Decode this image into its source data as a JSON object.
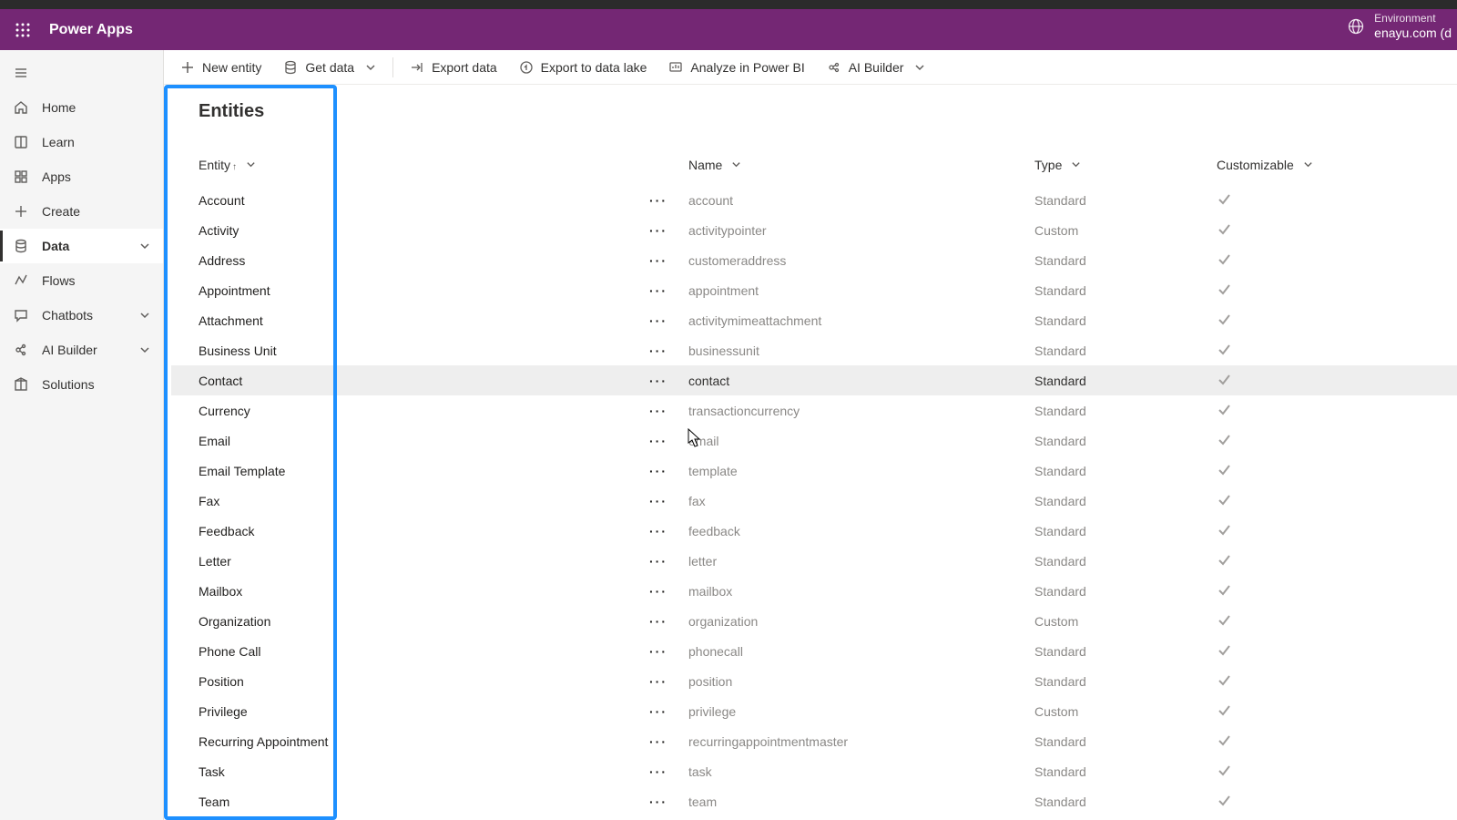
{
  "header": {
    "app_title": "Power Apps",
    "env_label": "Environment",
    "env_value": "enayu.com (d"
  },
  "nav": {
    "items": [
      {
        "key": "hamburger",
        "label": "",
        "icon": "menu",
        "chev": false
      },
      {
        "key": "home",
        "label": "Home",
        "icon": "home",
        "chev": false
      },
      {
        "key": "learn",
        "label": "Learn",
        "icon": "book",
        "chev": false
      },
      {
        "key": "apps",
        "label": "Apps",
        "icon": "apps",
        "chev": false
      },
      {
        "key": "create",
        "label": "Create",
        "icon": "plus",
        "chev": false
      },
      {
        "key": "data",
        "label": "Data",
        "icon": "data",
        "chev": true,
        "selected": true
      },
      {
        "key": "flows",
        "label": "Flows",
        "icon": "flows",
        "chev": false
      },
      {
        "key": "chatbots",
        "label": "Chatbots",
        "icon": "chat",
        "chev": true
      },
      {
        "key": "aibuilder",
        "label": "AI Builder",
        "icon": "ai",
        "chev": true
      },
      {
        "key": "solutions",
        "label": "Solutions",
        "icon": "package",
        "chev": false
      }
    ]
  },
  "toolbar": {
    "new_entity": "New entity",
    "get_data": "Get data",
    "export_data": "Export data",
    "export_lake": "Export to data lake",
    "analyze": "Analyze in Power BI",
    "ai_builder": "AI Builder"
  },
  "page": {
    "title": "Entities"
  },
  "columns": {
    "entity": "Entity",
    "name": "Name",
    "type": "Type",
    "customizable": "Customizable"
  },
  "rows": [
    {
      "entity": "Account",
      "name": "account",
      "type": "Standard",
      "cust": true
    },
    {
      "entity": "Activity",
      "name": "activitypointer",
      "type": "Custom",
      "cust": true
    },
    {
      "entity": "Address",
      "name": "customeraddress",
      "type": "Standard",
      "cust": true
    },
    {
      "entity": "Appointment",
      "name": "appointment",
      "type": "Standard",
      "cust": true
    },
    {
      "entity": "Attachment",
      "name": "activitymimeattachment",
      "type": "Standard",
      "cust": true
    },
    {
      "entity": "Business Unit",
      "name": "businessunit",
      "type": "Standard",
      "cust": true
    },
    {
      "entity": "Contact",
      "name": "contact",
      "type": "Standard",
      "cust": true,
      "selected": true
    },
    {
      "entity": "Currency",
      "name": "transactioncurrency",
      "type": "Standard",
      "cust": true
    },
    {
      "entity": "Email",
      "name": "email",
      "type": "Standard",
      "cust": true
    },
    {
      "entity": "Email Template",
      "name": "template",
      "type": "Standard",
      "cust": true
    },
    {
      "entity": "Fax",
      "name": "fax",
      "type": "Standard",
      "cust": true
    },
    {
      "entity": "Feedback",
      "name": "feedback",
      "type": "Standard",
      "cust": true
    },
    {
      "entity": "Letter",
      "name": "letter",
      "type": "Standard",
      "cust": true
    },
    {
      "entity": "Mailbox",
      "name": "mailbox",
      "type": "Standard",
      "cust": true
    },
    {
      "entity": "Organization",
      "name": "organization",
      "type": "Custom",
      "cust": true
    },
    {
      "entity": "Phone Call",
      "name": "phonecall",
      "type": "Standard",
      "cust": true
    },
    {
      "entity": "Position",
      "name": "position",
      "type": "Standard",
      "cust": true
    },
    {
      "entity": "Privilege",
      "name": "privilege",
      "type": "Custom",
      "cust": true
    },
    {
      "entity": "Recurring Appointment",
      "name": "recurringappointmentmaster",
      "type": "Standard",
      "cust": true
    },
    {
      "entity": "Task",
      "name": "task",
      "type": "Standard",
      "cust": true
    },
    {
      "entity": "Team",
      "name": "team",
      "type": "Standard",
      "cust": true
    }
  ]
}
